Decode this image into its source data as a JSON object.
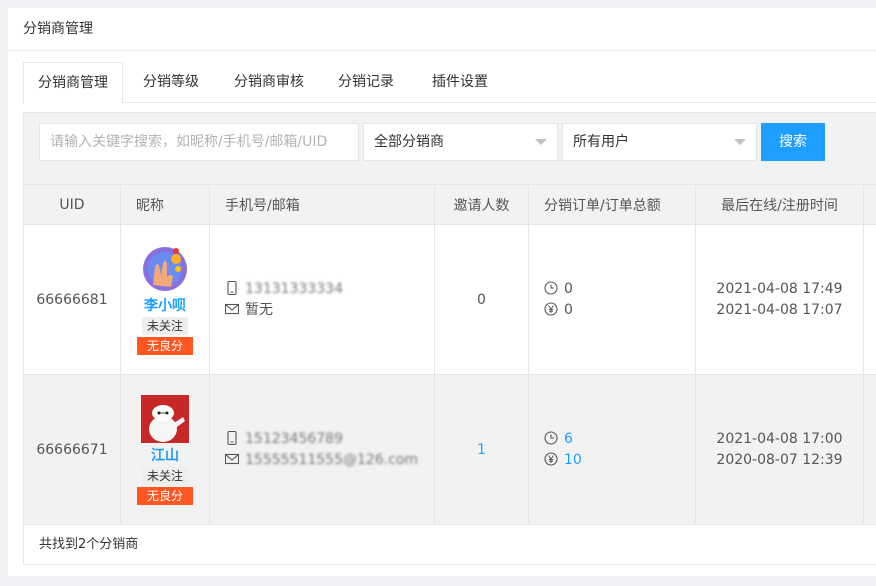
{
  "header": {
    "title": "分销商管理"
  },
  "tabs": [
    {
      "label": "分销商管理",
      "active": true
    },
    {
      "label": "分销等级"
    },
    {
      "label": "分销商审核"
    },
    {
      "label": "分销记录"
    },
    {
      "label": "插件设置"
    }
  ],
  "filters": {
    "search_placeholder": "请输入关键字搜索，如昵称/手机号/邮箱/UID",
    "distributor_select": "全部分销商",
    "user_select": "所有用户",
    "search_button": "搜索"
  },
  "table": {
    "columns": [
      "UID",
      "昵称",
      "手机号/邮箱",
      "邀请人数",
      "分销订单/订单总额",
      "最后在线/注册时间"
    ],
    "rows": [
      {
        "uid": "66666681",
        "name": "李小呗",
        "follow_badge": "未关注",
        "credit_badge": "无良分",
        "phone": "13131333334",
        "email": "暂无",
        "invites": "0",
        "orders": "0",
        "order_total": "0",
        "last_online": "2021-04-08 17:49",
        "registered": "2021-04-08 17:07"
      },
      {
        "uid": "66666671",
        "name": "江山",
        "follow_badge": "未关注",
        "credit_badge": "无良分",
        "phone": "15123456789",
        "email": "15555511555@126.com",
        "invites": "1",
        "orders": "6",
        "order_total": "10",
        "last_online": "2021-04-08 17:00",
        "registered": "2020-08-07 12:39"
      }
    ]
  },
  "footer": {
    "summary": "共找到2个分销商"
  }
}
